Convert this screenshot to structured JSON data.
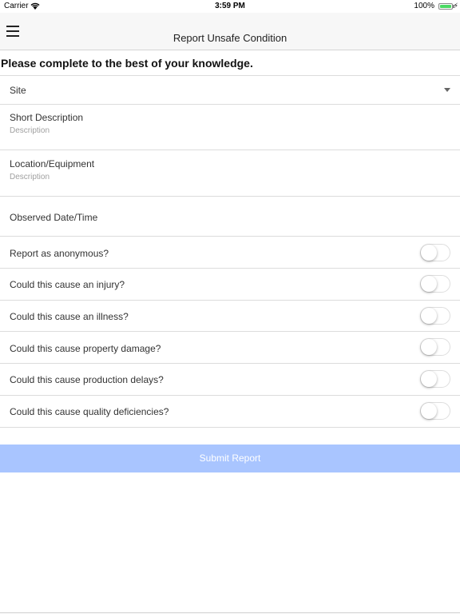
{
  "status_bar": {
    "carrier": "Carrier",
    "time": "3:59 PM",
    "battery_pct": "100%"
  },
  "navbar": {
    "title": "Report Unsafe Condition",
    "menu_icon": "hamburger-menu-icon"
  },
  "form": {
    "instructions": "Please complete to the best of your knowledge.",
    "site": {
      "label": "Site"
    },
    "short_description": {
      "label": "Short Description",
      "placeholder": "Description"
    },
    "location_equipment": {
      "label": "Location/Equipment",
      "placeholder": "Description"
    },
    "observed_datetime": {
      "label": "Observed Date/Time"
    },
    "toggles": [
      {
        "label": "Report as anonymous?",
        "checked": false
      },
      {
        "label": "Could this cause an injury?",
        "checked": false
      },
      {
        "label": "Could this cause an illness?",
        "checked": false
      },
      {
        "label": "Could this cause property damage?",
        "checked": false
      },
      {
        "label": "Could this cause production delays?",
        "checked": false
      },
      {
        "label": "Could this cause quality deficiencies?",
        "checked": false
      }
    ],
    "submit_label": "Submit Report"
  },
  "colors": {
    "submit_bg": "#a9c5ff",
    "battery": "#4cd964",
    "navbar_bg": "#f7f7f7"
  }
}
